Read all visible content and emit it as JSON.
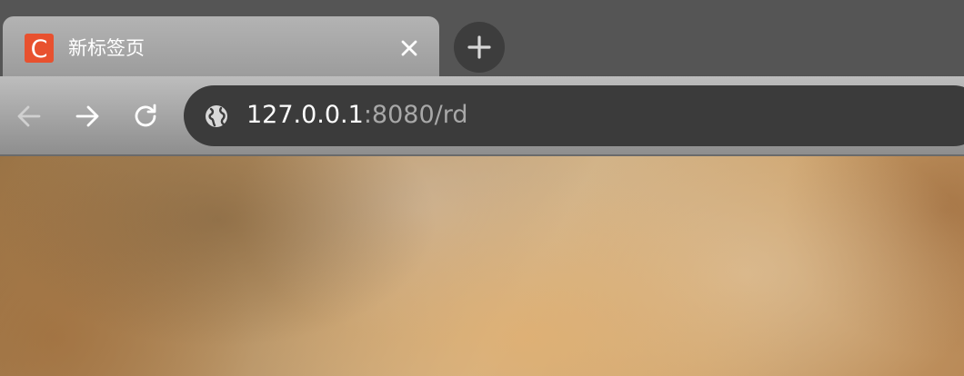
{
  "tab": {
    "title": "新标签页",
    "favicon_letter": "C",
    "favicon_color": "#e8512f"
  },
  "omnibox": {
    "url_host": "127.0.0.1",
    "url_rest": ":8080/rd"
  },
  "icons": {
    "tab_close": "close-icon",
    "new_tab": "plus-icon",
    "back": "arrow-left-icon",
    "forward": "arrow-right-icon",
    "reload": "reload-icon",
    "site_info": "globe-icon"
  },
  "colors": {
    "tabstrip_bg": "#555555",
    "omnibox_bg": "#3b3b3b",
    "url_host": "#ffffff",
    "url_rest": "#a8a8a8"
  }
}
